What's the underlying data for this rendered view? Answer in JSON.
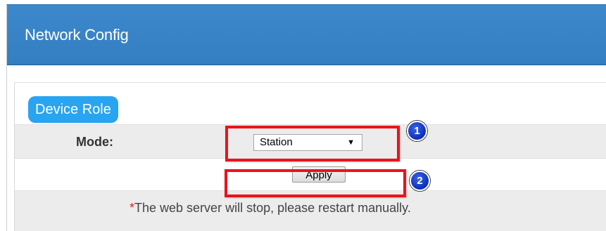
{
  "panel": {
    "title": "Network Config"
  },
  "device_role": {
    "badge_label": "Device Role"
  },
  "mode": {
    "label": "Mode:",
    "selected": "Station",
    "arrow_icon": "dropdown-arrow-icon"
  },
  "apply": {
    "button_label": "Apply"
  },
  "note": {
    "asterisk": "*",
    "text": "The web server will stop, please restart manually."
  },
  "callouts": {
    "first": "1",
    "second": "2"
  },
  "colors": {
    "header": "#3d88cc",
    "badge": "#28a4f0",
    "highlight": "#e8141c",
    "callout": "#0b2fb8"
  }
}
